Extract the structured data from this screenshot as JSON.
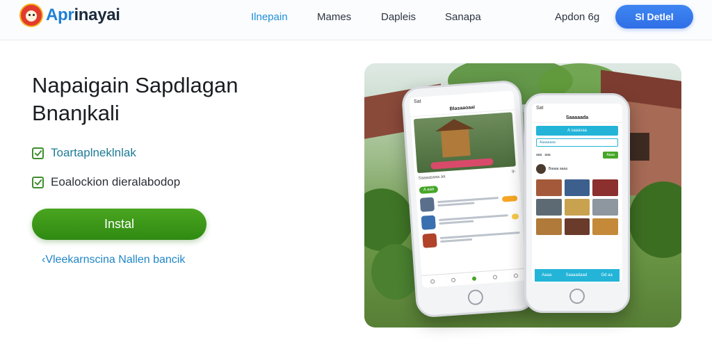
{
  "header": {
    "logo_text_a": "Apr",
    "logo_text_b": "inayai",
    "nav": [
      "Ilnepain",
      "Mames",
      "Dapleis",
      "Sanapa"
    ],
    "login": "Apdon  6g",
    "cta": "Sl Detlel"
  },
  "hero": {
    "headline_line1": "Napaigain Sapdlagan",
    "headline_line2": "Bnanȷkali",
    "features": [
      "Toartaplneklnlak",
      "Eoalockion dieralabodop"
    ],
    "install_label": "Instal",
    "more_link": "‹Vleekarnscina Nallen bancik"
  },
  "phone1": {
    "status": "Sat",
    "title": "Blasaaoaai",
    "meta_left": "Saaaasaaa aa",
    "meta_right": "9▫",
    "chip": "A aaa"
  },
  "phone2": {
    "status": "Sat",
    "title": "Saaaaada",
    "head": "A saaasaa",
    "input": "Aaaaaaaa",
    "controls": [
      "aaa",
      "aaa"
    ],
    "button": "Aaaa",
    "profile": "Baaaa aaaa",
    "bar": [
      "Aaaa",
      "Saaaadaad",
      "Gd aa"
    ]
  },
  "colors": {
    "accent": "#3f86f2",
    "install_green": "#3e9a1a",
    "link": "#1f86c8",
    "teal": "#23b4d8"
  }
}
